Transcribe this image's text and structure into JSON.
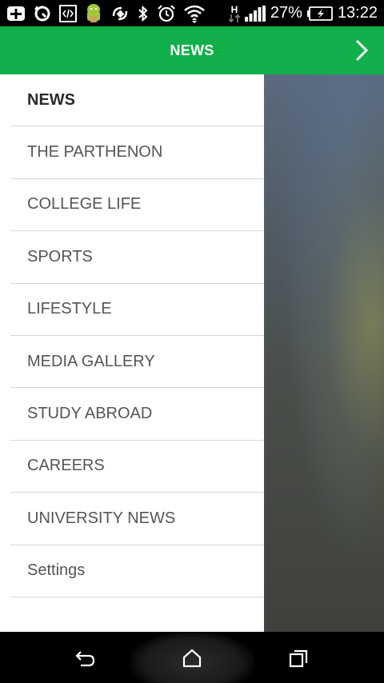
{
  "status_bar": {
    "battery_percent": "27%",
    "time": "13:22",
    "network_type": "H",
    "icons": [
      "add-box-icon",
      "sync-icon",
      "code-icon",
      "android-icon",
      "phone-rotate-icon",
      "bluetooth-icon",
      "alarm-icon",
      "wifi-icon",
      "network-h-icon",
      "signal-icon",
      "battery-icon"
    ]
  },
  "app_bar": {
    "title": "NEWS",
    "next_icon": "chevron-right-icon",
    "color": "#11b04a"
  },
  "drawer": {
    "items": [
      {
        "label": "NEWS",
        "active": true
      },
      {
        "label": "THE PARTHENON",
        "active": false
      },
      {
        "label": "COLLEGE LIFE",
        "active": false
      },
      {
        "label": "SPORTS",
        "active": false
      },
      {
        "label": "LIFESTYLE",
        "active": false
      },
      {
        "label": "MEDIA GALLERY",
        "active": false
      },
      {
        "label": "STUDY ABROAD",
        "active": false
      },
      {
        "label": "CAREERS",
        "active": false
      },
      {
        "label": "UNIVERSITY NEWS",
        "active": false
      },
      {
        "label": "Settings",
        "active": false
      }
    ]
  },
  "nav_bar": {
    "buttons": [
      "back-icon",
      "home-icon",
      "recents-icon"
    ]
  }
}
